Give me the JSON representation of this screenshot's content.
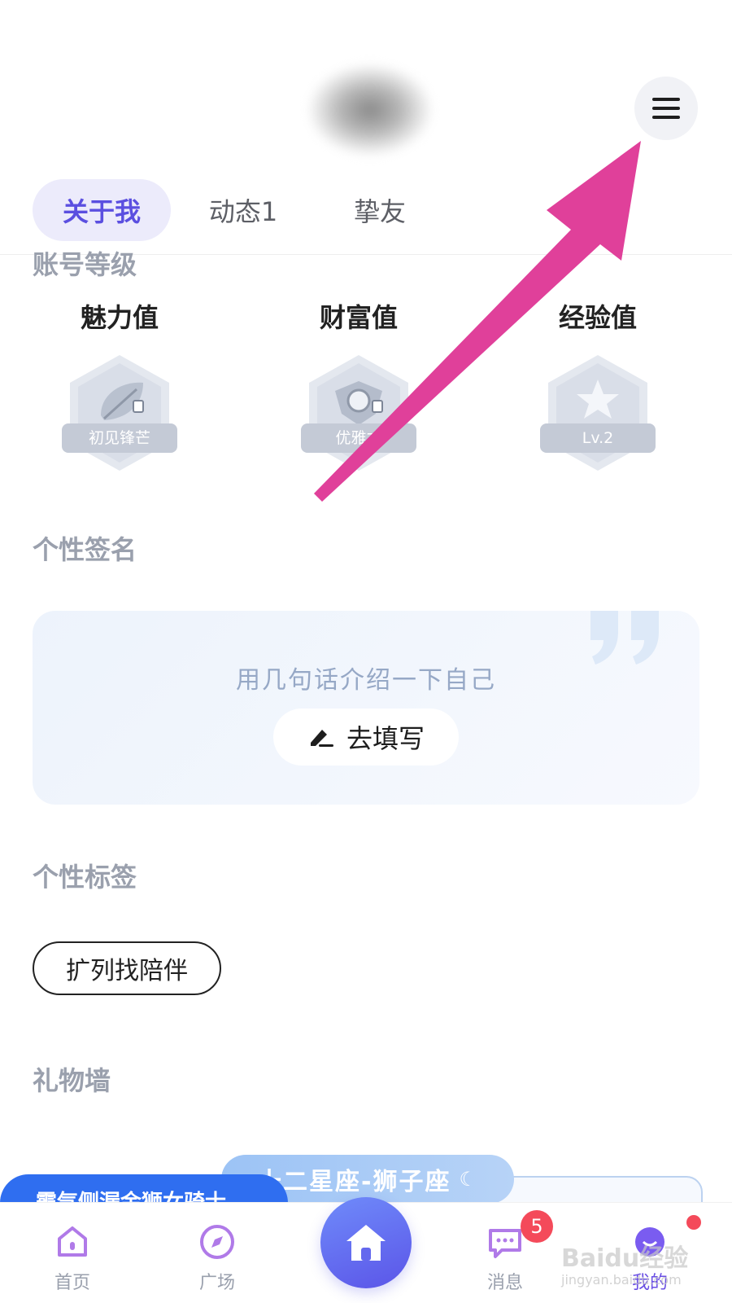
{
  "header": {
    "menu_icon": "hamburger-menu-icon"
  },
  "tabs": [
    {
      "label": "关于我",
      "active": true
    },
    {
      "label": "动态1",
      "active": false
    },
    {
      "label": "挚友",
      "active": false
    }
  ],
  "account_level": {
    "title": "账号等级",
    "items": [
      {
        "name": "魅力值",
        "badge": "初见锋芒",
        "icon": "leaf-icon"
      },
      {
        "name": "财富值",
        "badge": "优雅才",
        "icon": "shield-gem-icon"
      },
      {
        "name": "经验值",
        "badge": "Lv.2",
        "icon": "star-icon"
      }
    ]
  },
  "signature": {
    "title": "个性签名",
    "hint": "用几句话介绍一下自己",
    "button_label": "去填写"
  },
  "personal_tags": {
    "title": "个性标签",
    "tags": [
      "扩列找陪伴"
    ]
  },
  "gift_wall": {
    "title": "礼物墙",
    "banner": "十二星座-狮子座",
    "pill_text": "霸气侧漏金狮女骑士"
  },
  "bottom_nav": {
    "items": [
      {
        "label": "首页",
        "icon": "home-outline-icon"
      },
      {
        "label": "广场",
        "icon": "compass-icon"
      },
      {
        "label": "",
        "icon": "center-home-icon"
      },
      {
        "label": "消息",
        "icon": "chat-bubble-icon"
      },
      {
        "label": "我的",
        "icon": "profile-face-icon"
      }
    ],
    "message_count": "5"
  },
  "watermark": {
    "text": "Baidu经验",
    "sub": "jingyan.baidu.com"
  },
  "colors": {
    "accent": "#5b4fe0",
    "annotation_arrow": "#e0409a",
    "badge_red": "#f44a5a"
  }
}
